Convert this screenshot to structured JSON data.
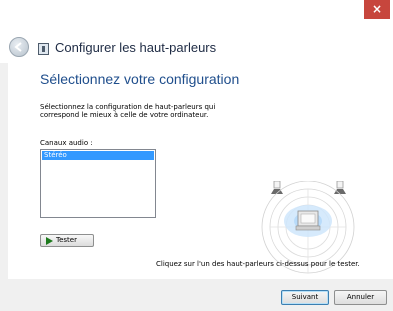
{
  "window": {
    "close_label": "×",
    "title": "Configurer les haut-parleurs"
  },
  "content": {
    "heading": "Sélectionnez votre configuration",
    "instruction": "Sélectionnez la configuration de haut-parleurs qui correspond le mieux à celle de votre ordinateur.",
    "channels_label": "Canaux audio :",
    "channels_options": [
      "Stéréo"
    ],
    "test_button_label": "Tester",
    "hint": "Cliquez sur l'un des haut-parleurs ci-dessus pour le tester."
  },
  "footer": {
    "next_label": "Suivant",
    "cancel_label": "Annuler"
  },
  "colors": {
    "heading": "#1f4e8c",
    "selection": "#3399ff",
    "close": "#c7463d"
  }
}
